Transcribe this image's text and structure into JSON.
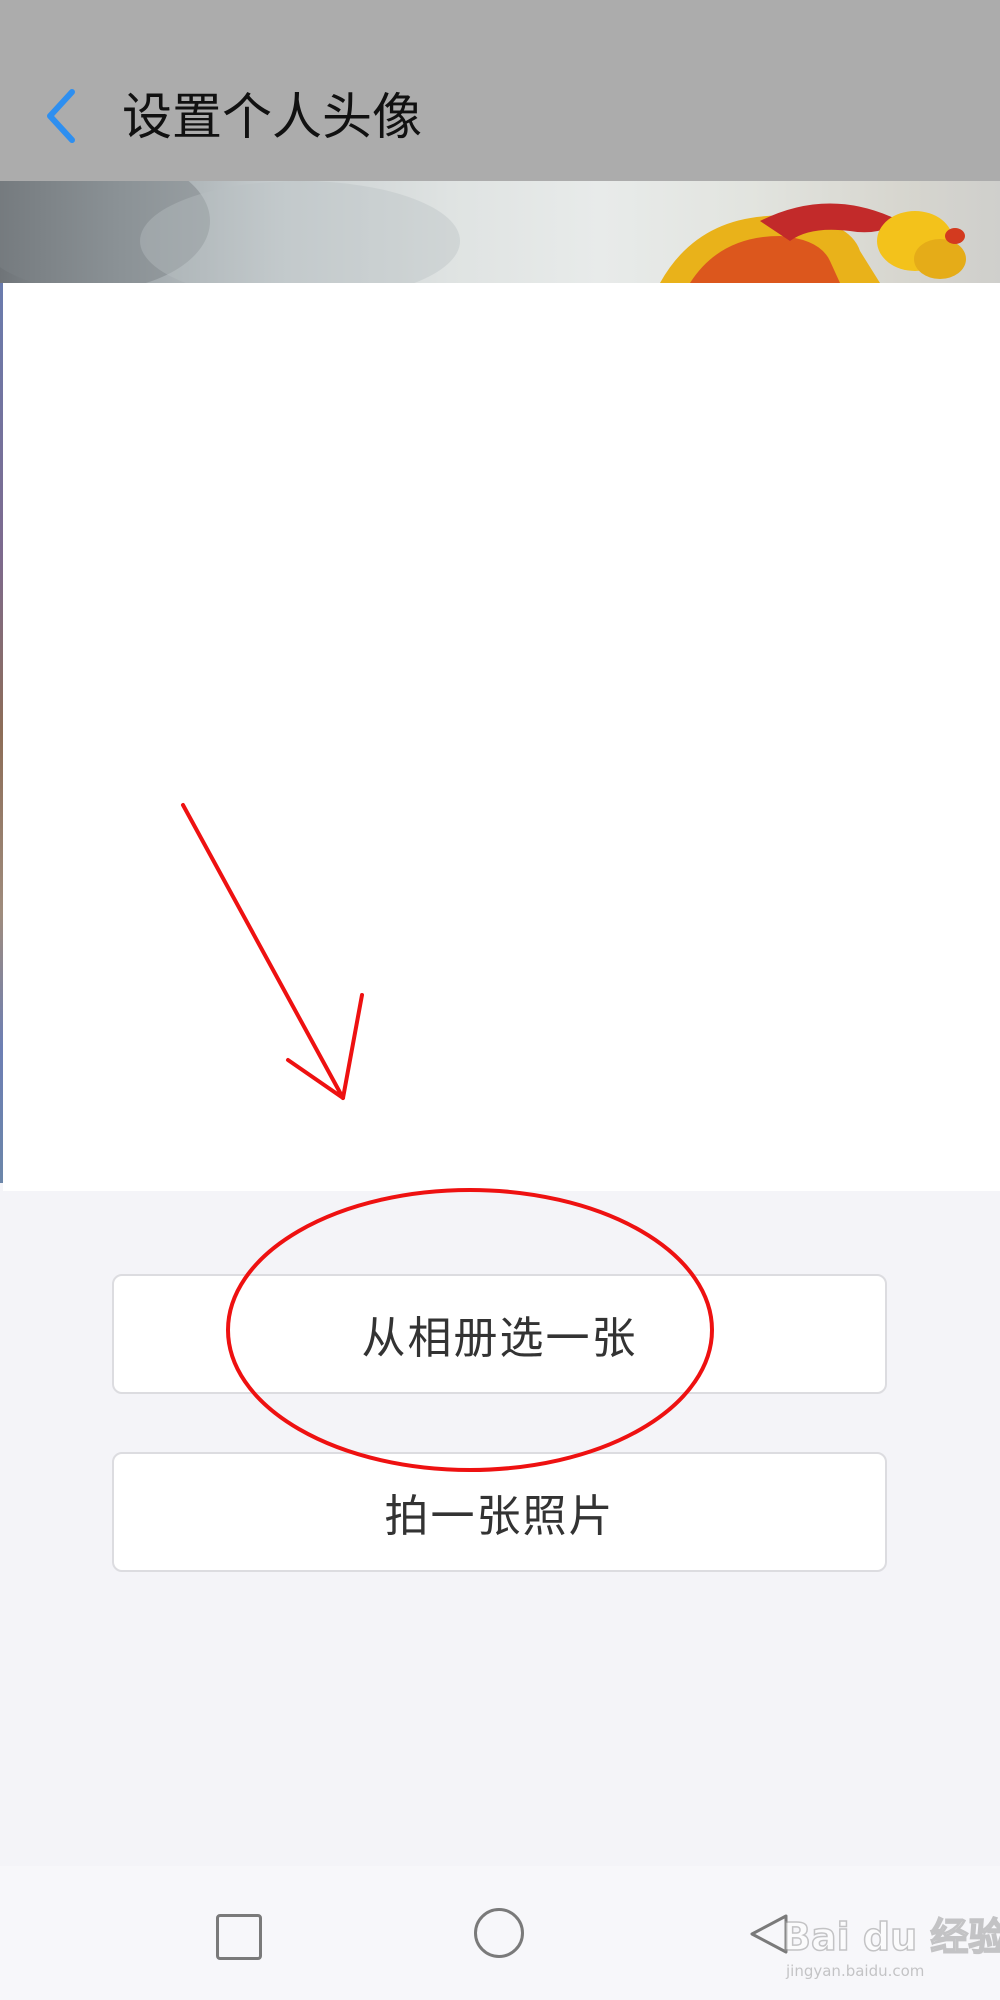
{
  "header": {
    "title": "设置个人头像",
    "back_icon": "chevron-left-icon",
    "back_color": "#2e8ff0",
    "background": "#acacac"
  },
  "options": {
    "album_label": "从相册选一张",
    "camera_label": "拍一张照片"
  },
  "annotation": {
    "color": "#ee1111",
    "arrow": "arrow-icon",
    "highlight": "ellipse-highlight"
  },
  "nav": {
    "recent_icon": "square-icon",
    "home_icon": "circle-icon",
    "back_icon": "triangle-back-icon"
  },
  "watermark": {
    "brand": "Bai du 经验",
    "url": "jingyan.baidu.com"
  }
}
